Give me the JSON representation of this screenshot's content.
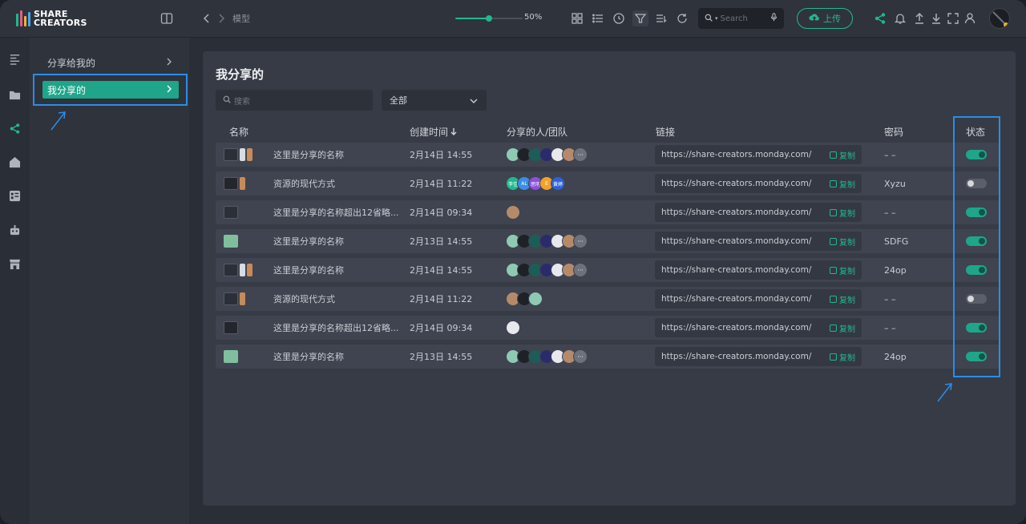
{
  "app": {
    "logo_line1": "SHARE",
    "logo_line2": "CREATORS"
  },
  "topbar": {
    "breadcrumb": "模型",
    "zoom": {
      "label": "50%",
      "value": 0.5
    },
    "search_placeholder": "Search",
    "upload_label": "上传"
  },
  "nav": {
    "items": [
      {
        "label": "分享给我的",
        "active": false
      },
      {
        "label": "我分享的",
        "active": true
      }
    ]
  },
  "main": {
    "title": "我分享的",
    "search_placeholder": "搜索",
    "filter_value": "全部",
    "columns": {
      "name": "名称",
      "created": "创建时间",
      "shared_with": "分享的人/团队",
      "link": "链接",
      "password": "密码",
      "status": "状态"
    },
    "copy_label": "复制",
    "rows": [
      {
        "name": "这里是分享的名称",
        "created": "2月14日 14:55",
        "link": "https://share-creators.monday.com/",
        "password": "– –",
        "enabled": true,
        "thumbs": [
          "group",
          "doc",
          "person"
        ],
        "avatars": [
          "img",
          "dark",
          "teal",
          "blue",
          "white",
          "person",
          "more"
        ]
      },
      {
        "name": "资源的现代方式",
        "created": "2月14日 11:22",
        "link": "https://share-creators.monday.com/",
        "password": "Xyzu",
        "enabled": false,
        "thumbs": [
          "folder",
          "person"
        ],
        "avatars": [
          "t1",
          "t2",
          "t3",
          "t4",
          "t5"
        ]
      },
      {
        "name": "这里是分享的名称超出12省略...",
        "created": "2月14日 09:34",
        "link": "https://share-creators.monday.com/",
        "password": "– –",
        "enabled": true,
        "thumbs": [
          "group"
        ],
        "avatars": [
          "person"
        ]
      },
      {
        "name": "这里是分享的名称",
        "created": "2月13日 14:55",
        "link": "https://share-creators.monday.com/",
        "password": "SDFG",
        "enabled": true,
        "thumbs": [
          "image"
        ],
        "avatars": [
          "img",
          "dark",
          "teal",
          "blue",
          "white",
          "person",
          "more"
        ]
      },
      {
        "name": "这里是分享的名称",
        "created": "2月14日 14:55",
        "link": "https://share-creators.monday.com/",
        "password": "24op",
        "enabled": true,
        "thumbs": [
          "group",
          "doc",
          "person"
        ],
        "avatars": [
          "img",
          "dark",
          "teal",
          "blue",
          "white",
          "person",
          "more"
        ]
      },
      {
        "name": "资源的现代方式",
        "created": "2月14日 11:22",
        "link": "https://share-creators.monday.com/",
        "password": "– –",
        "enabled": false,
        "thumbs": [
          "group",
          "person"
        ],
        "avatars": [
          "person",
          "dark",
          "img"
        ]
      },
      {
        "name": "这里是分享的名称超出12省略...",
        "created": "2月14日 09:34",
        "link": "https://share-creators.monday.com/",
        "password": "– –",
        "enabled": true,
        "thumbs": [
          "folder"
        ],
        "avatars": [
          "github"
        ]
      },
      {
        "name": "这里是分享的名称",
        "created": "2月13日 14:55",
        "link": "https://share-creators.monday.com/",
        "password": "24op",
        "enabled": true,
        "thumbs": [
          "image"
        ],
        "avatars": [
          "img",
          "dark",
          "teal",
          "blue",
          "white",
          "person",
          "more"
        ]
      }
    ],
    "team_labels": [
      "李佳",
      "AL",
      "思明",
      "E",
      "黄婷"
    ]
  },
  "colors": {
    "accent": "#1fb98f",
    "active_nav": "#1fa58a",
    "annotation": "#2a8de8"
  }
}
